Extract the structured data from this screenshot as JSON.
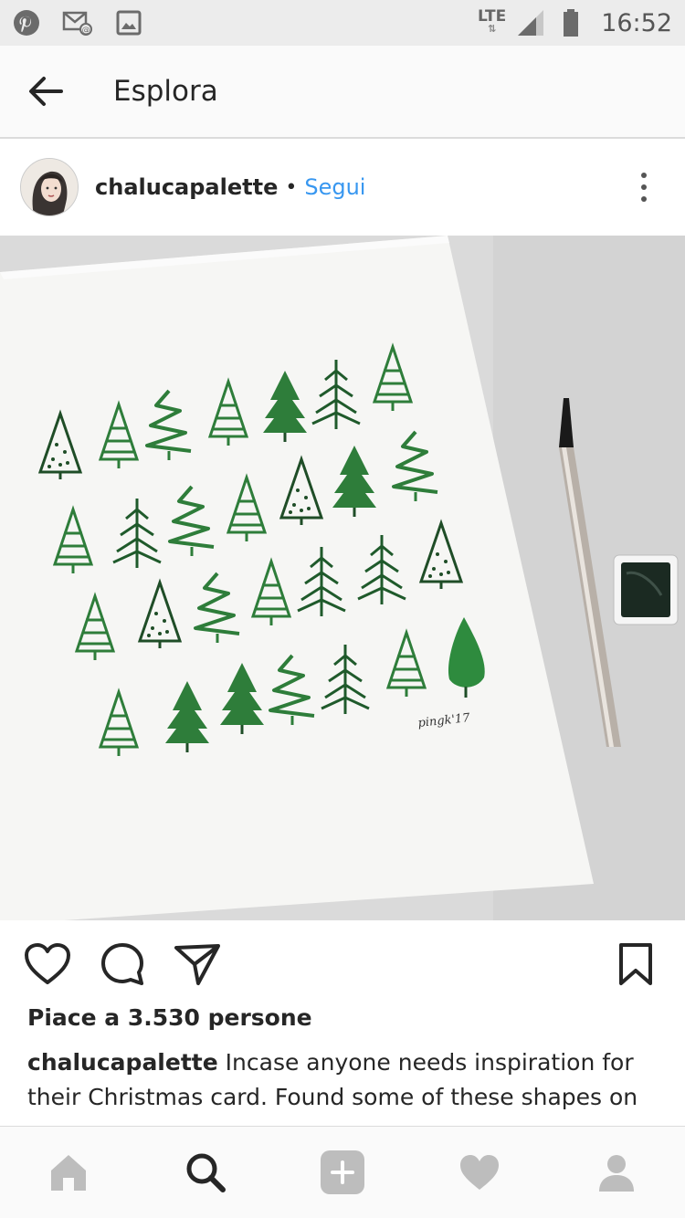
{
  "status_bar": {
    "network": "LTE",
    "time": "16:52",
    "icons": [
      "pinterest-icon",
      "email-notification-icon",
      "image-notification-icon",
      "signal-icon",
      "battery-icon"
    ]
  },
  "header": {
    "title": "Esplora",
    "back_icon": "back-arrow-icon"
  },
  "post": {
    "username": "chalucapalette",
    "separator": "•",
    "follow_label": "Segui",
    "likes_text": "Piace a 3.530 persone",
    "caption_user": "chalucapalette",
    "caption_text": "Incase anyone needs inspiration for their Christmas card. Found some of these shapes on",
    "image_signature": "pingk'17"
  },
  "actions": {
    "icons": [
      "heart-icon",
      "comment-icon",
      "share-icon",
      "bookmark-icon"
    ]
  },
  "bottom_nav": {
    "icons": [
      "home-icon",
      "search-icon",
      "add-icon",
      "activity-heart-icon",
      "profile-icon"
    ],
    "active": "search-icon"
  },
  "colors": {
    "link_blue": "#3897f0",
    "tree_green": "#2e7d3a",
    "dark_green": "#1f4d27"
  }
}
